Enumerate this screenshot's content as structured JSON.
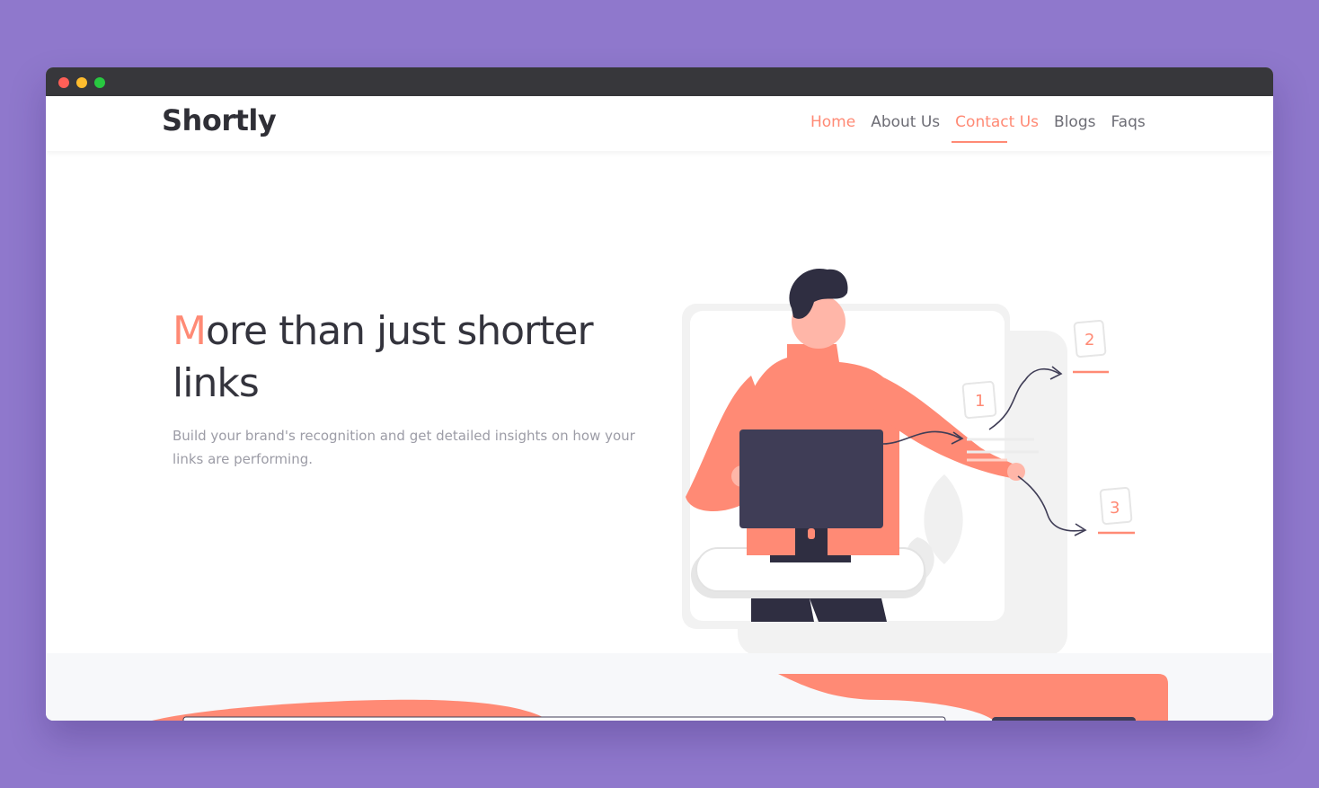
{
  "window": {
    "controls": [
      "close",
      "minimize",
      "maximize"
    ]
  },
  "brand": {
    "logo": "Shortly"
  },
  "nav": {
    "items": [
      {
        "label": "Home",
        "accent": true
      },
      {
        "label": "About Us",
        "accent": false
      },
      {
        "label": "Contact Us",
        "accent": true,
        "active": true
      },
      {
        "label": "Blogs",
        "accent": false
      },
      {
        "label": "Faqs",
        "accent": false
      }
    ]
  },
  "hero": {
    "title_first_letter": "M",
    "title_rest": "ore than just shorter links",
    "subtitle": "Build your brand's recognition and get detailed insights on how your links are performing."
  },
  "illustration": {
    "step_labels": [
      "1",
      "2",
      "3"
    ]
  },
  "colors": {
    "background": "#8f78cc",
    "accent": "#ff8a75",
    "dark": "#34343d",
    "muted": "#9c9ca6",
    "titlebar": "#37373b"
  }
}
